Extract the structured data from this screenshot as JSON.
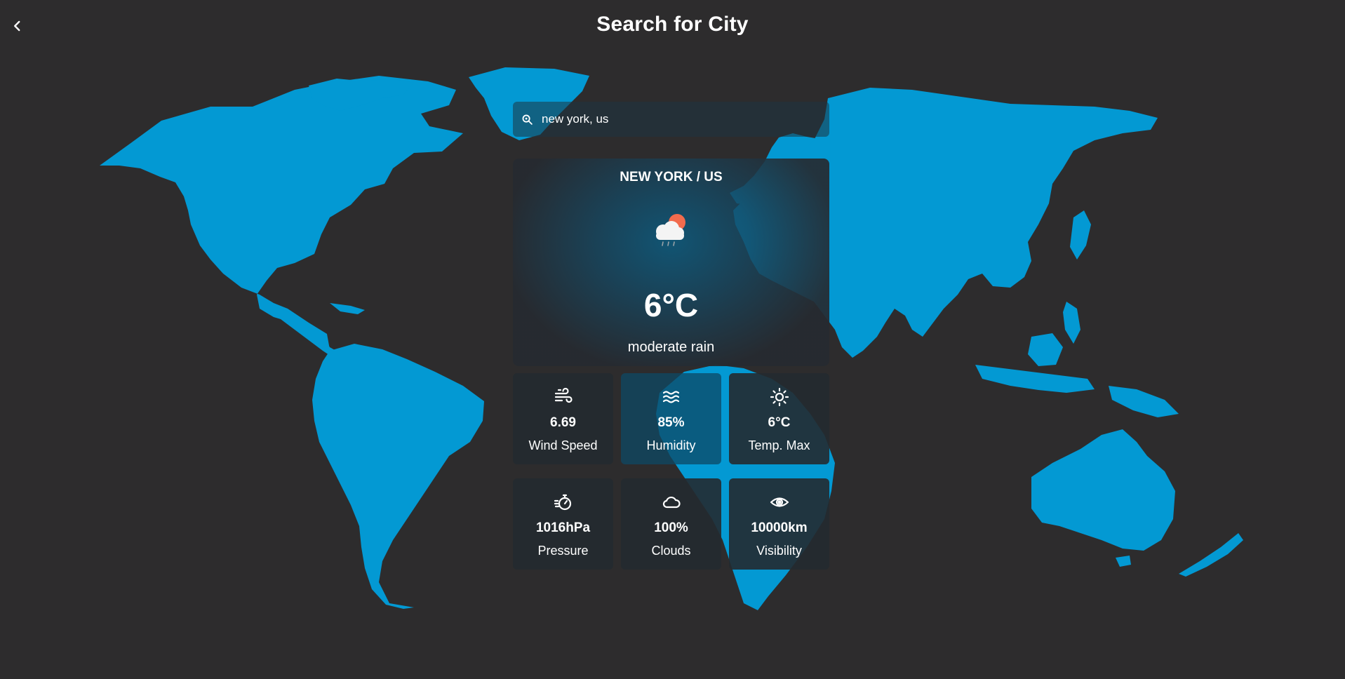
{
  "header": {
    "title": "Search for City"
  },
  "search": {
    "value": "new york, us"
  },
  "weather": {
    "city": "NEW YORK / US",
    "temperature": "6°C",
    "description": "moderate rain",
    "icon": "cloud-sun-rain-icon"
  },
  "stats": [
    {
      "icon": "wind-icon",
      "value": "6.69",
      "label": "Wind Speed"
    },
    {
      "icon": "waves-icon",
      "value": "85%",
      "label": "Humidity"
    },
    {
      "icon": "sun-icon",
      "value": "6°C",
      "label": "Temp. Max"
    },
    {
      "icon": "stopwatch-icon",
      "value": "1016hPa",
      "label": "Pressure"
    },
    {
      "icon": "cloud-icon",
      "value": "100%",
      "label": "Clouds"
    },
    {
      "icon": "eye-icon",
      "value": "10000km",
      "label": "Visibility"
    }
  ],
  "colors": {
    "background": "#2d2c2d",
    "map": "#0399d3",
    "sun": "#f26b4d"
  }
}
